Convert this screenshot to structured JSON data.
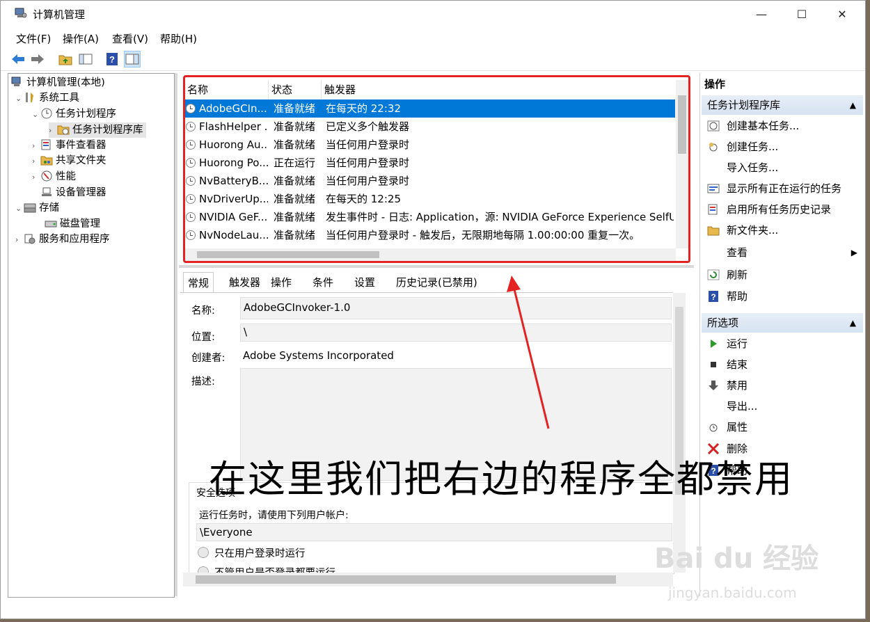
{
  "window": {
    "title": "计算机管理",
    "minimize": "—",
    "maximize": "☐",
    "close": "✕"
  },
  "menu": {
    "file": "文件(F)",
    "action": "操作(A)",
    "view": "查看(V)",
    "help": "帮助(H)"
  },
  "tree": {
    "root": "计算机管理(本地)",
    "system_tools": "系统工具",
    "task_scheduler": "任务计划程序",
    "task_library": "任务计划程序库",
    "event_viewer": "事件查看器",
    "shared_folders": "共享文件夹",
    "performance": "性能",
    "device_manager": "设备管理器",
    "storage": "存储",
    "disk_management": "磁盘管理",
    "services": "服务和应用程序"
  },
  "tasklist": {
    "headers": {
      "name": "名称",
      "status": "状态",
      "trigger": "触发器"
    },
    "rows": [
      {
        "name": "AdobeGCIn...",
        "status": "准备就绪",
        "trigger": "在每天的 22:32"
      },
      {
        "name": "FlashHelper ...",
        "status": "准备就绪",
        "trigger": "已定义多个触发器"
      },
      {
        "name": "Huorong Au...",
        "status": "准备就绪",
        "trigger": "当任何用户登录时"
      },
      {
        "name": "Huorong Po...",
        "status": "正在运行",
        "trigger": "当任何用户登录时"
      },
      {
        "name": "NvBatteryB...",
        "status": "准备就绪",
        "trigger": "当任何用户登录时"
      },
      {
        "name": "NvDriverUp...",
        "status": "准备就绪",
        "trigger": "在每天的 12:25"
      },
      {
        "name": "NVIDIA GeF...",
        "status": "准备就绪",
        "trigger": "发生事件时 - 日志: Application，源: NVIDIA GeForce Experience SelfUpdat"
      },
      {
        "name": "NvNodeLau...",
        "status": "准备就绪",
        "trigger": "当任何用户登录时 - 触发后，无限期地每隔 1.00:00:00 重复一次。"
      }
    ]
  },
  "tabs": {
    "general": "常规",
    "triggers": "触发器",
    "actions": "操作",
    "conditions": "条件",
    "settings": "设置",
    "history": "历史记录(已禁用)"
  },
  "detail": {
    "name_label": "名称:",
    "name_value": "AdobeGCInvoker-1.0",
    "location_label": "位置:",
    "location_value": "\\",
    "author_label": "创建者:",
    "author_value": "Adobe Systems Incorporated",
    "desc_label": "描述:",
    "security_title": "安全选项",
    "run_as_label": "运行任务时，请使用下列用户帐户:",
    "run_as_value": "\\Everyone",
    "radio1": "只在用户登录时运行",
    "radio2": "不管用户是否登录都要运行"
  },
  "actions_pane": {
    "header": "操作",
    "group1": "任务计划程序库",
    "items1": [
      "创建基本任务...",
      "创建任务...",
      "导入任务...",
      "显示所有正在运行的任务",
      "启用所有任务历史记录",
      "新文件夹...",
      "查看",
      "刷新",
      "帮助"
    ],
    "group2": "所选项",
    "items2": [
      "运行",
      "结束",
      "禁用",
      "导出...",
      "属性",
      "删除",
      "帮助"
    ]
  },
  "annotation": "在这里我们把右边的程序全都禁用",
  "watermark": {
    "line1": "Bai du 经验",
    "line2": "jingyan.baidu.com"
  },
  "colors": {
    "selection": "#0078d7",
    "annotation_box": "#e52222",
    "arrow": "#e52222"
  }
}
